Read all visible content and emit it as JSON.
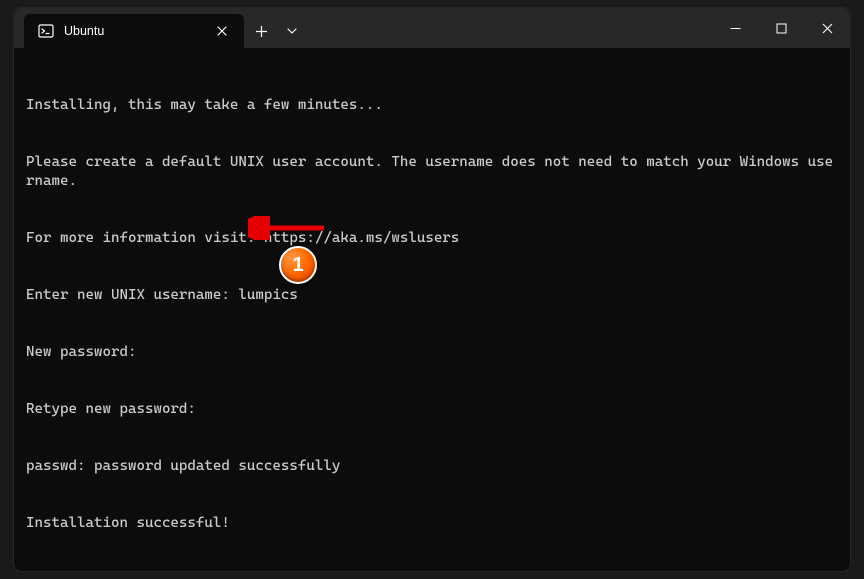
{
  "tab": {
    "title": "Ubuntu",
    "icon": "terminal-icon"
  },
  "terminal": {
    "lines": [
      "Installing, this may take a few minutes...",
      "Please create a default UNIX user account. The username does not need to match your Windows username.",
      "For more information visit: https://aka.ms/wslusers",
      "Enter new UNIX username: lumpics",
      "New password:",
      "Retype new password:",
      "passwd: password updated successfully",
      "Installation successful!"
    ]
  },
  "annotation": {
    "badge_number": "1"
  }
}
